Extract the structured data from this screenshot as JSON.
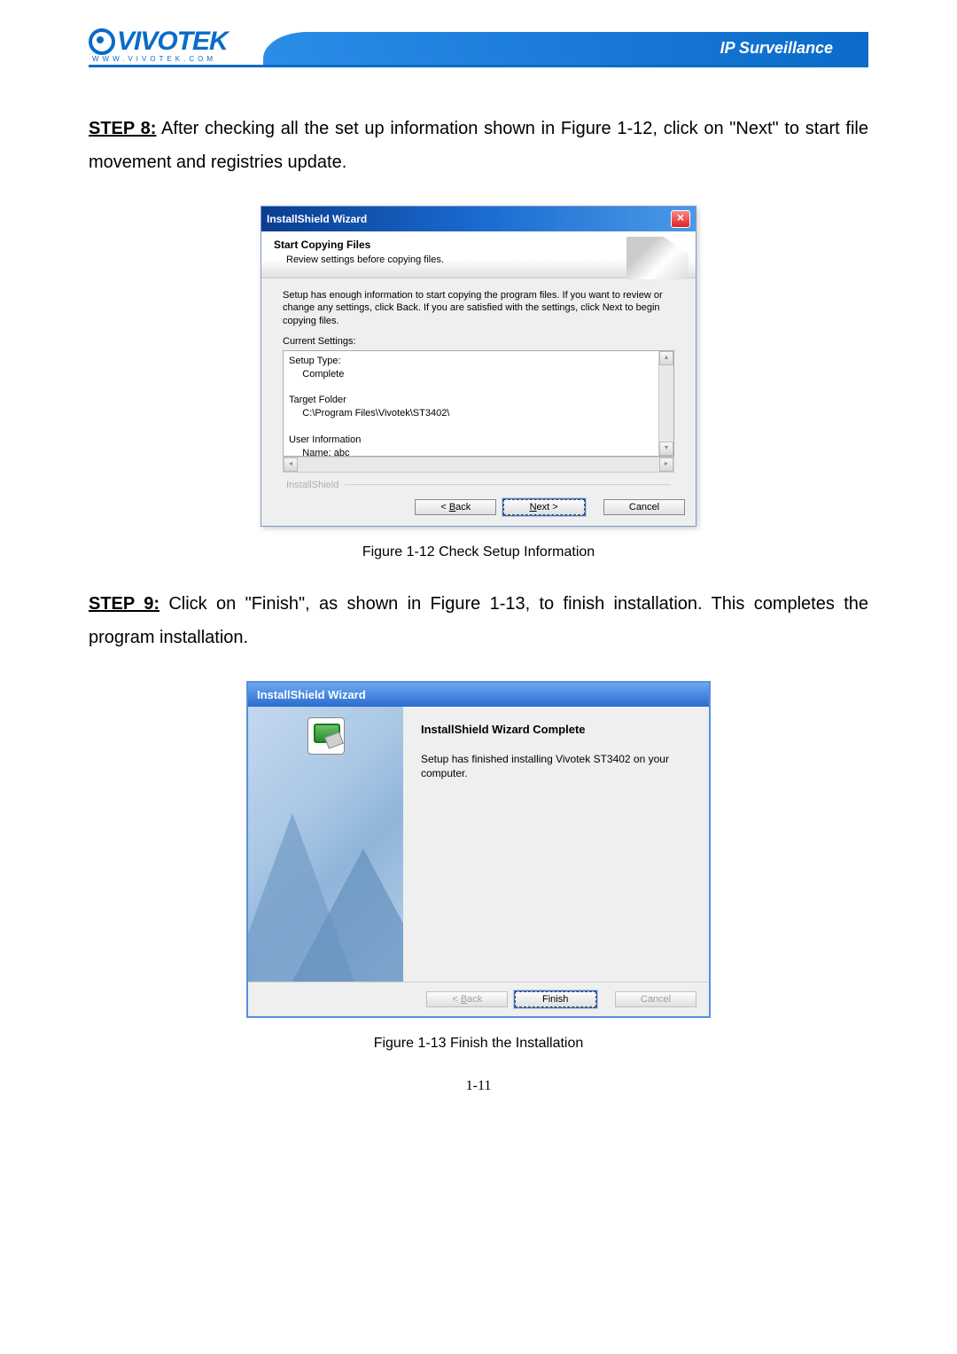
{
  "header": {
    "logo_text": "VIVOTEK",
    "logo_sub": "WWW.VIVOTEK.COM",
    "right": "IP Surveillance"
  },
  "step8": {
    "label": "STEP 8:",
    "text": " After checking all the set up information shown in Figure 1-12, click on \"Next\" to start file movement and registries update."
  },
  "dialog1": {
    "title": "InstallShield Wizard",
    "header_title": "Start Copying Files",
    "header_sub": "Review settings before copying files.",
    "instr": "Setup has enough information to start copying the program files.  If you want to review or change any settings, click Back.  If you are satisfied with the settings, click Next to begin copying files.",
    "current_label": "Current Settings:",
    "textbox": "Setup Type:\n     Complete\n\nTarget Folder\n     C:\\Program Files\\Vivotek\\ST3402\\\n\nUser Information\n     Name: abc\n     Company: VIVOTEK",
    "brand": "InstallShield",
    "btn_back": "< Back",
    "btn_next": "Next >",
    "btn_cancel": "Cancel"
  },
  "caption1": "Figure 1-12 Check Setup Information",
  "step9": {
    "label": "STEP 9:",
    "text": " Click on \"Finish\", as shown in Figure 1-13, to finish installation. This completes the program installation."
  },
  "dialog2": {
    "title": "InstallShield Wizard",
    "heading": "InstallShield Wizard Complete",
    "body": "Setup has finished installing Vivotek ST3402 on your computer.",
    "btn_back": "< Back",
    "btn_finish": "Finish",
    "btn_cancel": "Cancel"
  },
  "caption2": "Figure 1-13 Finish the Installation",
  "page_number": "1-11"
}
